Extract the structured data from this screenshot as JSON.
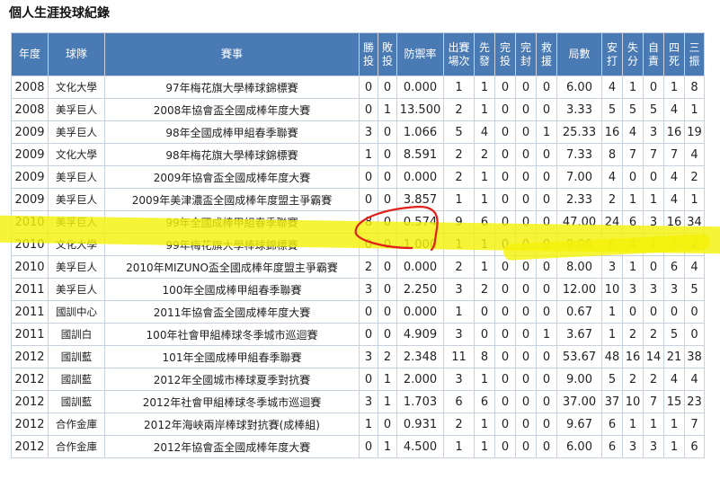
{
  "page_title": "個人生涯投球紀錄",
  "headers": [
    "年度",
    "球隊",
    "賽事",
    "勝\n投",
    "敗\n投",
    "防禦率",
    "出賽\n場次",
    "先\n發",
    "完\n投",
    "完\n封",
    "救\n援",
    "局數",
    "安\n打",
    "失\n分",
    "自\n責",
    "四\n死",
    "三\n振"
  ],
  "rows": [
    [
      "2008",
      "文化大學",
      "97年梅花旗大學棒球錦標賽",
      "0",
      "0",
      "0.000",
      "1",
      "1",
      "0",
      "0",
      "0",
      "6.00",
      "4",
      "1",
      "0",
      "1",
      "8"
    ],
    [
      "2008",
      "美孚巨人",
      "2008年協會盃全國成棒年度大賽",
      "0",
      "1",
      "13.500",
      "2",
      "1",
      "0",
      "0",
      "0",
      "3.33",
      "5",
      "5",
      "5",
      "4",
      "1"
    ],
    [
      "2009",
      "美孚巨人",
      "98年全國成棒甲組春季聯賽",
      "3",
      "0",
      "1.066",
      "5",
      "4",
      "0",
      "0",
      "1",
      "25.33",
      "16",
      "4",
      "3",
      "16",
      "19"
    ],
    [
      "2009",
      "文化大學",
      "98年梅花旗大學棒球錦標賽",
      "1",
      "0",
      "8.591",
      "2",
      "2",
      "0",
      "0",
      "0",
      "7.33",
      "8",
      "7",
      "7",
      "7",
      "4"
    ],
    [
      "2009",
      "美孚巨人",
      "2009年協會盃全國成棒年度大賽",
      "0",
      "0",
      "0.000",
      "2",
      "1",
      "0",
      "0",
      "0",
      "7.00",
      "4",
      "0",
      "0",
      "4",
      "2"
    ],
    [
      "2009",
      "美孚巨人",
      "2009年美津濃盃全國成棒年度盟主爭霸賽",
      "0",
      "0",
      "3.857",
      "1",
      "1",
      "0",
      "0",
      "0",
      "2.33",
      "2",
      "1",
      "1",
      "4",
      "1"
    ],
    [
      "2010",
      "美孚巨人",
      "99年全國成棒甲組春季聯賽",
      "8",
      "0",
      "0.574",
      "9",
      "6",
      "0",
      "0",
      "0",
      "47.00",
      "24",
      "6",
      "3",
      "16",
      "34"
    ],
    [
      "2010",
      "文化大學",
      "99年梅花旗大學棒球錦標賽",
      "0",
      "0",
      "1.000",
      "1",
      "1",
      "0",
      "0",
      "0",
      "9.00",
      "6",
      "4",
      "1",
      "3",
      "2"
    ],
    [
      "2010",
      "美孚巨人",
      "2010年MIZUNO盃全國成棒年度盟主爭霸賽",
      "2",
      "0",
      "0.000",
      "2",
      "1",
      "0",
      "0",
      "0",
      "8.00",
      "3",
      "1",
      "0",
      "6",
      "4"
    ],
    [
      "2011",
      "美孚巨人",
      "100年全國成棒甲組春季聯賽",
      "3",
      "0",
      "2.250",
      "3",
      "2",
      "0",
      "0",
      "0",
      "12.00",
      "10",
      "3",
      "3",
      "3",
      "5"
    ],
    [
      "2011",
      "國訓中心",
      "2011年協會盃全國成棒年度大賽",
      "0",
      "0",
      "0.000",
      "1",
      "0",
      "0",
      "0",
      "0",
      "0.67",
      "1",
      "0",
      "0",
      "0",
      "0"
    ],
    [
      "2011",
      "國訓白",
      "100年社會甲組棒球冬季城市巡迴賽",
      "0",
      "0",
      "4.909",
      "3",
      "0",
      "0",
      "0",
      "1",
      "3.67",
      "1",
      "2",
      "2",
      "5",
      "0"
    ],
    [
      "2012",
      "國訓藍",
      "101年全國成棒甲組春季聯賽",
      "3",
      "2",
      "2.348",
      "11",
      "8",
      "0",
      "0",
      "0",
      "53.67",
      "48",
      "16",
      "14",
      "21",
      "38"
    ],
    [
      "2012",
      "國訓藍",
      "2012年全國城市棒球夏季對抗賽",
      "0",
      "1",
      "2.000",
      "3",
      "1",
      "0",
      "0",
      "0",
      "9.00",
      "5",
      "2",
      "2",
      "4",
      "4"
    ],
    [
      "2012",
      "國訓藍",
      "2012年社會甲組棒球冬季城市巡迴賽",
      "3",
      "1",
      "1.703",
      "6",
      "6",
      "0",
      "0",
      "0",
      "37.00",
      "37",
      "10",
      "7",
      "15",
      "23"
    ],
    [
      "2012",
      "合作金庫",
      "2012年海峽兩岸棒球對抗賽(成棒組)",
      "1",
      "0",
      "0.931",
      "2",
      "1",
      "0",
      "0",
      "0",
      "9.67",
      "6",
      "1",
      "1",
      "1",
      "7"
    ],
    [
      "2012",
      "合作金庫",
      "2012年協會盃全國成棒年度大賽",
      "0",
      "1",
      "4.500",
      "1",
      "1",
      "0",
      "0",
      "0",
      "6.00",
      "6",
      "3",
      "3",
      "1",
      "6"
    ]
  ],
  "colors": {
    "header_bg": "#4a7ab3",
    "header_text": "#ffffff",
    "border": "#c8d2de",
    "highlight": "#f4f20a",
    "annotation": "#e0201a"
  }
}
